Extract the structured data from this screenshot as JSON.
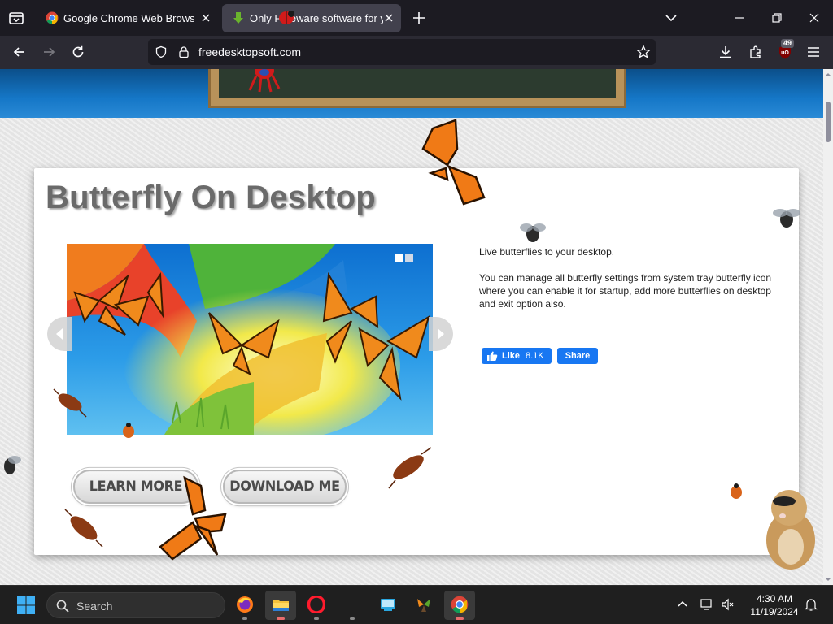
{
  "browser": {
    "tabs": [
      {
        "title": "Google Chrome Web Browser",
        "favicon": "chrome-icon"
      },
      {
        "title": "Only Freeware software for you",
        "favicon": "download-arrow-icon",
        "active": true
      }
    ],
    "url": "freedesktopsoft.com",
    "extension_badge": "49",
    "theme": {
      "tab_bar": "#1c1b22",
      "nav_bar": "#2b2a33",
      "active_tab": "#42414d"
    }
  },
  "page": {
    "title": "Butterfly On Desktop",
    "description": [
      "Live butterflies to your desktop.",
      "You can manage all butterfly settings from system tray butterfly icon where you can enable it for startup, add more butterflies on desktop and exit option also."
    ],
    "facebook": {
      "like_label": "Like",
      "like_count": "8.1K",
      "share_label": "Share"
    },
    "buttons": {
      "learn_more": "LEARN MORE",
      "download": "DOWNLOAD ME"
    },
    "colors": {
      "title": "#6a6a6a",
      "fb_blue": "#1877f2",
      "hero_blue": "#1577c7"
    }
  },
  "taskbar": {
    "search_placeholder": "Search",
    "time": "4:30 AM",
    "date": "11/19/2024",
    "apps": [
      "firefox-icon",
      "file-explorer-icon",
      "opera-icon",
      "blank-app-icon",
      "remote-desktop-icon",
      "butterfly-app-icon",
      "chrome-icon"
    ]
  }
}
